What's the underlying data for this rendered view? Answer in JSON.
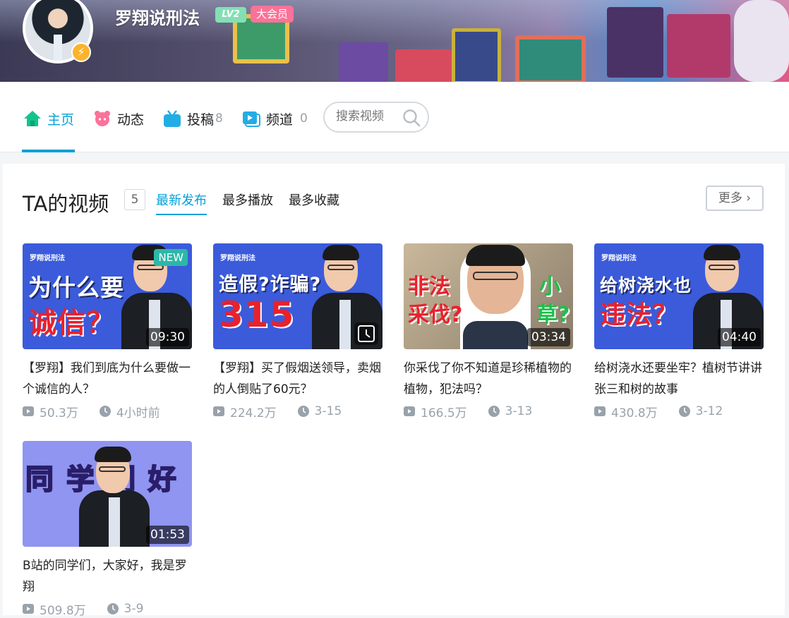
{
  "user": {
    "name": "罗翔说刑法",
    "level": "LV2",
    "vip_label": "大会员"
  },
  "nav": {
    "home": "主页",
    "dynamic": "动态",
    "posts": "投稿",
    "posts_count": "8",
    "channels": "频道",
    "channels_count": "0",
    "search_placeholder": "搜索视频"
  },
  "videos_section": {
    "title": "TA的视频",
    "count": "5",
    "tabs": [
      "最新发布",
      "最多播放",
      "最多收藏"
    ],
    "more": "更多"
  },
  "videos": [
    {
      "thumb_tag": "罗翔说刑法",
      "thumb_line1": "为什么要",
      "thumb_line2": "诚信？",
      "badge": "NEW",
      "duration": "09:30",
      "title": "【罗翔】我们到底为什么要做一个诚信的人？",
      "plays": "50.3万",
      "time": "4小时前"
    },
    {
      "thumb_tag": "罗翔说刑法",
      "thumb_line1": "造假?诈骗?",
      "thumb_line2": "315",
      "title": "【罗翔】买了假烟送领导，卖烟的人倒贴了60元？",
      "plays": "224.2万",
      "time": "3-15"
    },
    {
      "thumb_line1": "非法",
      "thumb_line2": "采伐?",
      "thumb_line3": "小",
      "thumb_line4": "草?",
      "duration": "03:34",
      "title": "你采伐了你不知道是珍稀植物的植物，犯法吗？",
      "plays": "166.5万",
      "time": "3-13"
    },
    {
      "thumb_tag": "罗翔说刑法",
      "thumb_line1": "给树浇水也",
      "thumb_line2": "违法？",
      "duration": "04:40",
      "title": "给树浇水还要坐牢？植树节讲讲张三和树的故事",
      "plays": "430.8万",
      "time": "3-12"
    },
    {
      "thumb_line1": "同 学 们 好",
      "duration": "01:53",
      "title": "B站的同学们，大家好，我是罗翔",
      "plays": "509.8万",
      "time": "3-9"
    }
  ],
  "colors": {
    "accent": "#00a1d6",
    "vip": "#fb7299",
    "level": "#82e0b4",
    "meta": "#99a2aa"
  }
}
